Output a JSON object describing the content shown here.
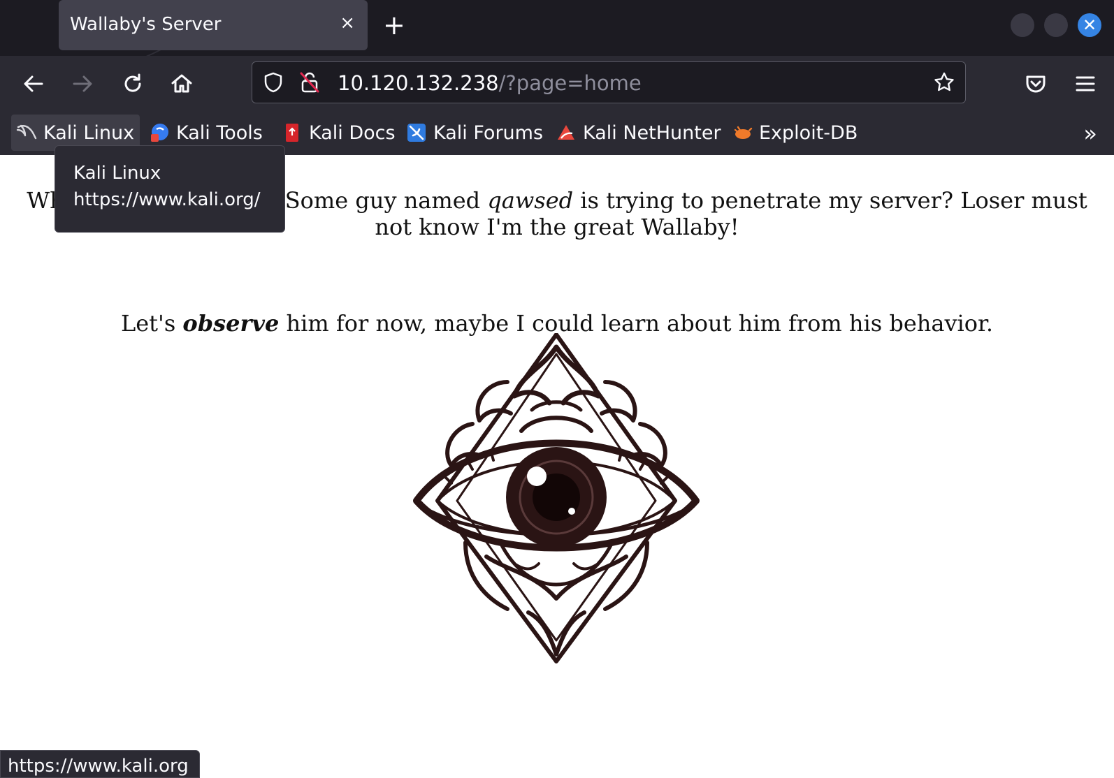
{
  "window": {
    "tab_title": "Wallaby's Server",
    "tab_close_glyph": "×",
    "new_tab_glyph": "+",
    "close_glyph": "✕",
    "accent_color": "#3584e4"
  },
  "navbar": {
    "back_icon": "arrow-left-icon",
    "forward_icon": "arrow-right-icon",
    "reload_icon": "reload-icon",
    "home_icon": "home-icon",
    "url_host": "10.120.132.238",
    "url_path": "/?page=home",
    "pocket_icon": "pocket-icon",
    "menu_icon": "hamburger-menu-icon"
  },
  "bookmarks": {
    "items": [
      {
        "label": "Kali Linux",
        "icon": "kali-dragon-icon"
      },
      {
        "label": "Kali Tools",
        "icon": "kali-tools-icon"
      },
      {
        "label": "Kali Docs",
        "icon": "kali-docs-icon"
      },
      {
        "label": "Kali Forums",
        "icon": "kali-forums-icon"
      },
      {
        "label": "Kali NetHunter",
        "icon": "kali-nethunter-icon"
      },
      {
        "label": "Exploit-DB",
        "icon": "exploit-db-icon"
      }
    ],
    "overflow_glyph": "»"
  },
  "tooltip": {
    "title": "Kali Linux",
    "url": "https://www.kali.org/"
  },
  "page": {
    "para1_before": "What the heck is this? Some guy named ",
    "para1_emphasis": "qawsed",
    "para1_after": " is trying to penetrate my server? Loser must not know I'm the great Wallaby!",
    "para2_before": "Let's ",
    "para2_emphasis": "observe",
    "para2_after": " him for now, maybe I could learn about him from his behavior.",
    "image": "all-seeing-eye-image"
  },
  "statusbar": {
    "text": "https://www.kali.org"
  }
}
